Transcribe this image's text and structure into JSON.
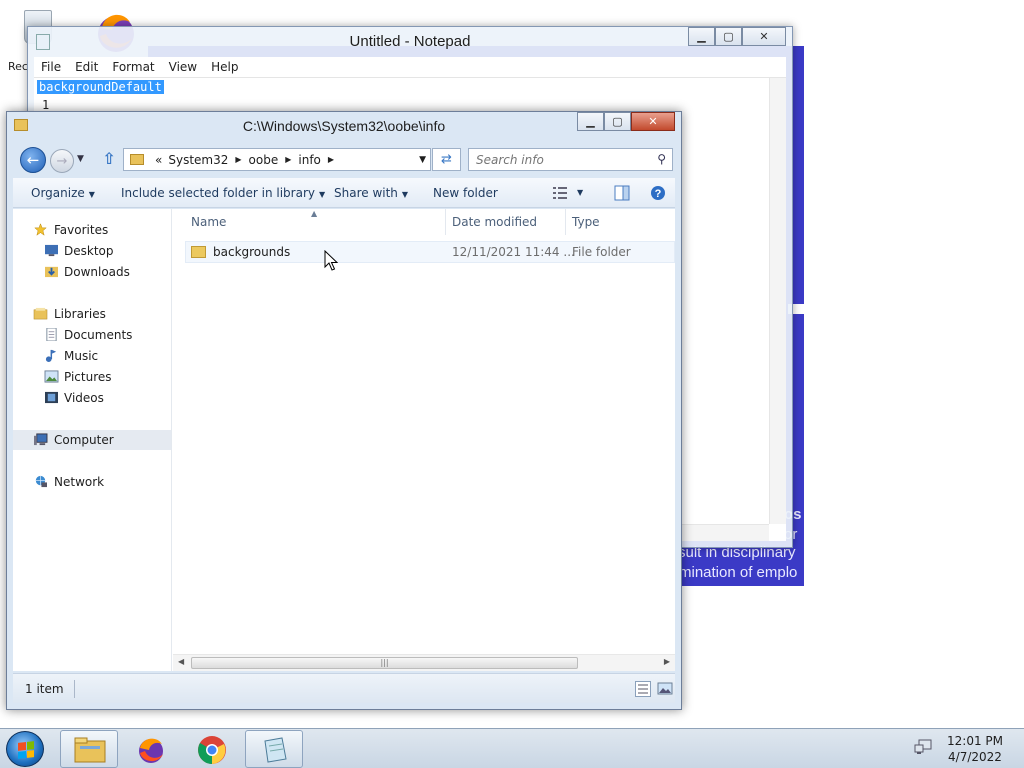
{
  "desktop": {
    "recycle_bin_label": "Rec"
  },
  "background_doc": {
    "text_lines": [
      "os",
      "or",
      "sult in disciplinary",
      "rmination of emplo"
    ]
  },
  "notepad": {
    "title": "Untitled - Notepad",
    "menu": [
      "File",
      "Edit",
      "Format",
      "View",
      "Help"
    ],
    "selected_text": "backgroundDefault",
    "second_line": "1"
  },
  "explorer": {
    "title": "C:\\Windows\\System32\\oobe\\info",
    "address": {
      "overflow": "«",
      "crumbs": [
        "System32",
        "oobe",
        "info"
      ]
    },
    "search_placeholder": "Search info",
    "toolbar": {
      "organize": "Organize",
      "include": "Include selected folder in library",
      "share": "Share with",
      "new_folder": "New folder"
    },
    "nav": {
      "favorites": "Favorites",
      "desktop": "Desktop",
      "downloads": "Downloads",
      "libraries": "Libraries",
      "documents": "Documents",
      "music": "Music",
      "pictures": "Pictures",
      "videos": "Videos",
      "computer": "Computer",
      "network": "Network"
    },
    "columns": [
      "Name",
      "Date modified",
      "Type"
    ],
    "files": [
      {
        "name": "backgrounds",
        "date": "12/11/2021 11:44 ...",
        "type": "File folder"
      }
    ],
    "status": "1 item"
  },
  "taskbar": {
    "time": "12:01 PM",
    "date": "4/7/2022"
  },
  "colors": {
    "accent": "#3399ff",
    "purple_doc": "#3b3ac6",
    "window_frame": "#dbe7f4"
  }
}
